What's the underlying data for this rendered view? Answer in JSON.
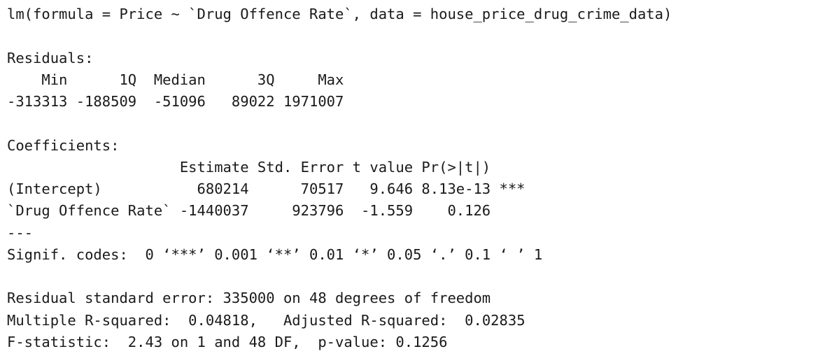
{
  "output": {
    "call": "lm(formula = Price ~ `Drug Offence Rate`, data = house_price_drug_crime_data)",
    "blank1": "",
    "residuals_title": "Residuals:",
    "residuals_header": "    Min      1Q  Median      3Q     Max ",
    "residuals_values": "-313313 -188509  -51096   89022 1971007 ",
    "blank2": "",
    "coefficients_title": "Coefficients:",
    "coef_header": "                    Estimate Std. Error t value Pr(>|t|)    ",
    "coef_row_intercept": "(Intercept)           680214      70517   9.646 8.13e-13 ***",
    "coef_row_drug": "`Drug Offence Rate` -1440037     923796  -1.559    0.126    ",
    "separator": "---",
    "signif_codes": "Signif. codes:  0 ‘***’ 0.001 ‘**’ 0.01 ‘*’ 0.05 ‘.’ 0.1 ‘ ’ 1",
    "blank3": "",
    "residual_se": "Residual standard error: 335000 on 48 degrees of freedom",
    "r_squared": "Multiple R-squared:  0.04818,\tAdjusted R-squared:  0.02835 ",
    "f_statistic": "F-statistic:  2.43 on 1 and 48 DF,  p-value: 0.1256"
  }
}
